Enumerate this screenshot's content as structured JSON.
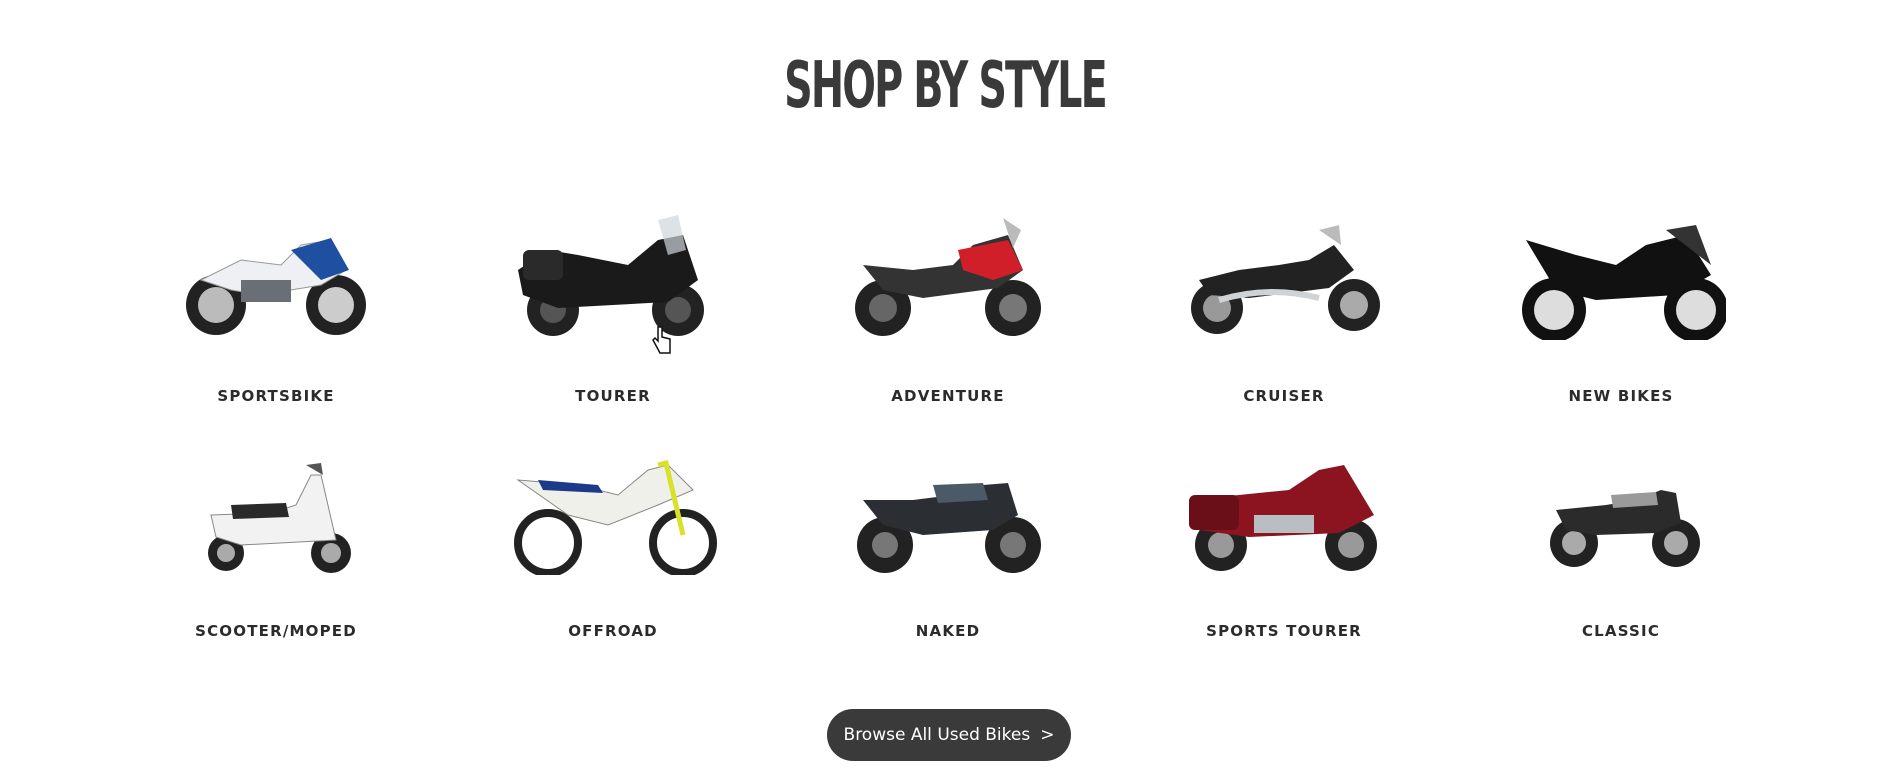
{
  "section": {
    "title": "SHOP BY STYLE"
  },
  "styles": [
    {
      "label": "SPORTSBIKE",
      "icon": "sportsbike-image",
      "color": "#1f4fa0"
    },
    {
      "label": "TOURER",
      "icon": "tourer-image",
      "color": "#1a1a1a"
    },
    {
      "label": "ADVENTURE",
      "icon": "adventure-image",
      "color": "#d11f2a"
    },
    {
      "label": "CRUISER",
      "icon": "cruiser-image",
      "color": "#222222"
    },
    {
      "label": "NEW BIKES",
      "icon": "new-bikes-image",
      "color": "#111111"
    },
    {
      "label": "SCOOTER/MOPED",
      "icon": "scooter-image",
      "color": "#f2f2f2"
    },
    {
      "label": "OFFROAD",
      "icon": "offroad-image",
      "color": "#1d3a8a"
    },
    {
      "label": "NAKED",
      "icon": "naked-image",
      "color": "#4a5a66"
    },
    {
      "label": "SPORTS TOURER",
      "icon": "sports-tourer-image",
      "color": "#8b1420"
    },
    {
      "label": "CLASSIC",
      "icon": "classic-image",
      "color": "#9a9a9a"
    }
  ],
  "browse_button": {
    "label": "Browse All Used Bikes",
    "chevron": ">"
  },
  "theme": {
    "button_bg": "#3a3a3a",
    "title_color": "#3a3a3a"
  }
}
